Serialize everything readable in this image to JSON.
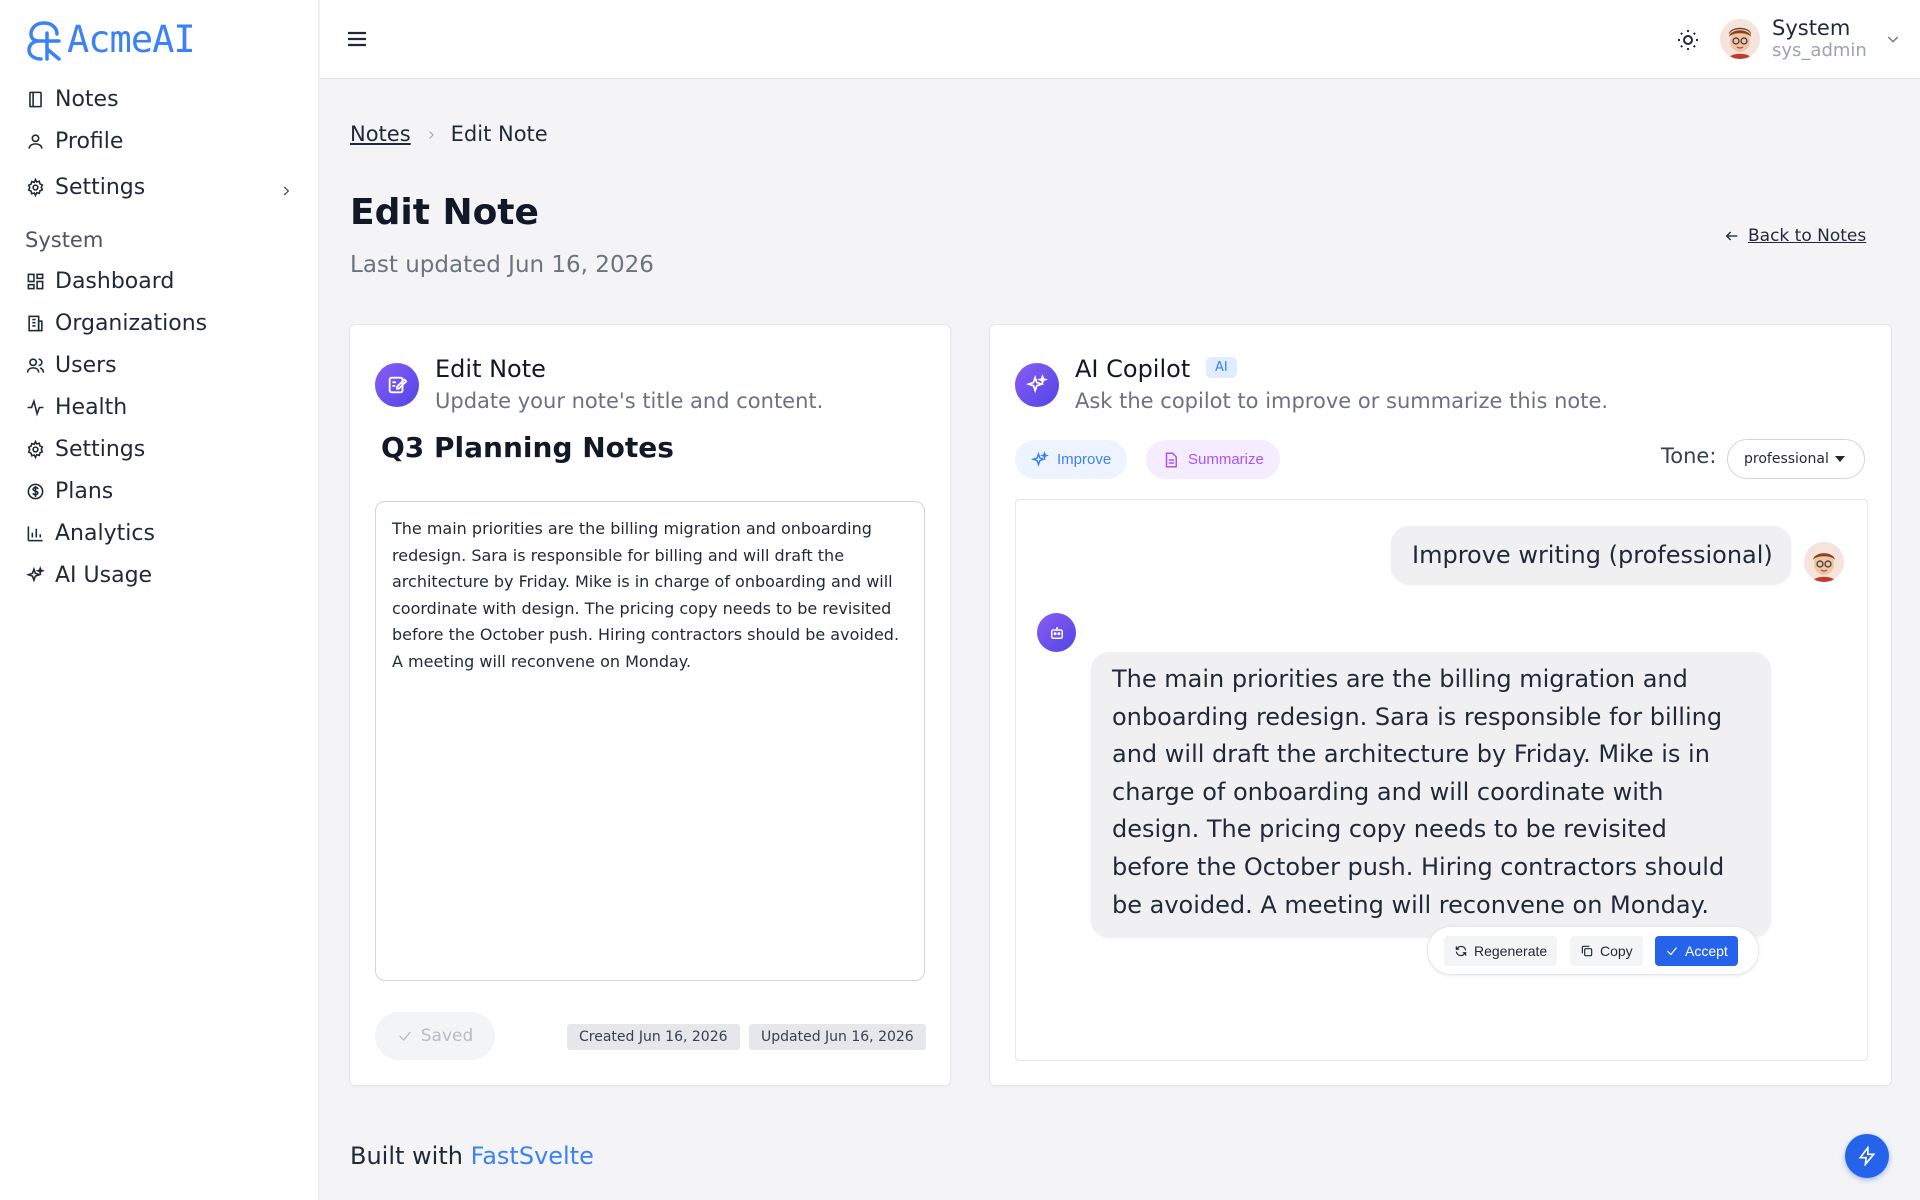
{
  "brand": {
    "name": "AcmeAI",
    "color": "#3b82f6"
  },
  "sidebar": {
    "top_items": [
      {
        "label": "Notes",
        "icon": "notebook-icon"
      },
      {
        "label": "Profile",
        "icon": "user-icon"
      },
      {
        "label": "Settings",
        "icon": "gear-icon"
      }
    ],
    "section_title": "System",
    "system_items": [
      {
        "label": "Dashboard",
        "icon": "dashboard-icon"
      },
      {
        "label": "Organizations",
        "icon": "building-icon"
      },
      {
        "label": "Users",
        "icon": "users-icon"
      },
      {
        "label": "Health",
        "icon": "activity-icon"
      },
      {
        "label": "Settings",
        "icon": "gear-icon"
      },
      {
        "label": "Plans",
        "icon": "dollar-icon"
      },
      {
        "label": "Analytics",
        "icon": "bar-chart-icon"
      },
      {
        "label": "AI Usage",
        "icon": "sparkles-icon"
      }
    ]
  },
  "topbar": {
    "user_name": "System",
    "user_handle": "sys_admin"
  },
  "breadcrumb": {
    "parent": "Notes",
    "current": "Edit Note"
  },
  "page": {
    "title": "Edit Note",
    "subtitle": "Last updated Jun 16, 2026",
    "back_label": "Back to Notes"
  },
  "editor": {
    "title": "Edit Note",
    "subtitle": "Update your note's title and content.",
    "note_title": "Q3 Planning Notes",
    "note_body": "The main priorities are the billing migration and onboarding redesign. Sara is responsible for billing and will draft the architecture by Friday. Mike is in charge of onboarding and will coordinate with design. The pricing copy needs to be revisited before the October push. Hiring contractors should be avoided. A meeting will reconvene on Monday.",
    "saved_label": "Saved",
    "created_label": "Created Jun 16, 2026",
    "updated_label": "Updated Jun 16, 2026"
  },
  "copilot": {
    "title": "AI Copilot",
    "badge": "AI",
    "subtitle": "Ask the copilot to improve or summarize this note.",
    "improve_label": "Improve",
    "summarize_label": "Summarize",
    "tone_label": "Tone:",
    "tone_value": "professional",
    "user_message": "Improve writing (professional)",
    "bot_message": "The main priorities are the billing migration and onboarding redesign. Sara is responsible for billing and will draft the architecture by Friday. Mike is in charge of onboarding and will coordinate with design. The pricing copy needs to be revisited before the October push. Hiring contractors should be avoided. A meeting will reconvene on Monday.",
    "regenerate_label": "Regenerate",
    "copy_label": "Copy",
    "accept_label": "Accept"
  },
  "footer": {
    "prefix": "Built with ",
    "link": "FastSvelte"
  }
}
